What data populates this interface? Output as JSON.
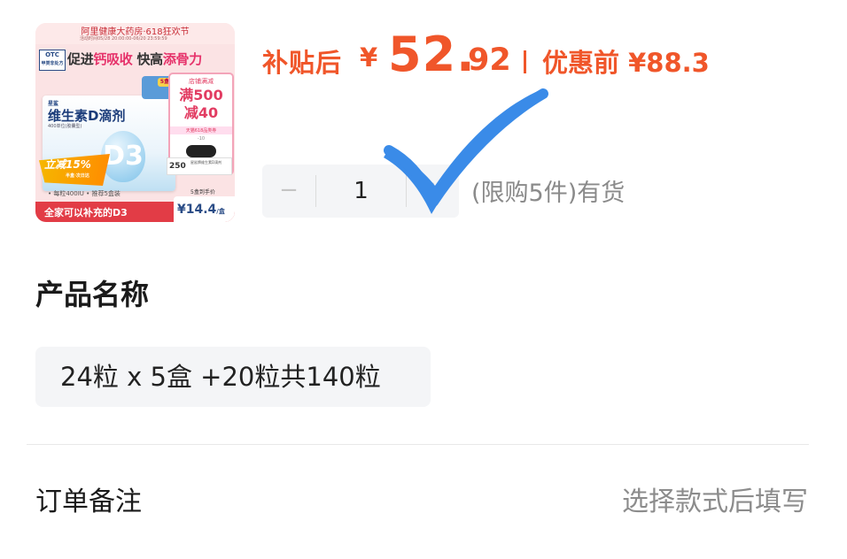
{
  "product_image": {
    "top_banner": "阿里健康大药房·618狂欢节",
    "date_text": "活动时间05/28 20:00:00-06/20 23:59:59",
    "otc_badge": "OTC",
    "otc_sub": "甲类非处方",
    "headline_part1": "促进",
    "headline_pink1": "钙吸收",
    "headline_part2": " 快高",
    "headline_pink2": "添骨力",
    "box_brand": "星鲨",
    "box_name": "维生素D滴剂",
    "box_spec": "400单位(胶囊型)",
    "box_d3": "D3",
    "box_count": "5盒",
    "promo_line1": "店铺满减",
    "promo_line2a": "满500",
    "promo_line2b": "减40",
    "promo_line3": "天猫618品类券",
    "promo_line4": "-10",
    "stamp_number": "250",
    "stamp_text": "星鲨牌维生素D滴剂",
    "flash_text": "立减15%",
    "flash_sub": "半盒·次日达",
    "bullets": "• 每粒400IU • 推荐5盒装",
    "per_unit_label": "5盒到手价",
    "slogan": "全家可以补充的D3",
    "unit_price": "¥14.4",
    "unit_price_suffix": "/盒"
  },
  "price": {
    "subsidy_label": "补贴后",
    "currency": "¥",
    "integer": "52.",
    "decimal": "92",
    "original_label": "优惠前 ¥88.3"
  },
  "quantity": {
    "minus": "−",
    "value": "1",
    "plus": "+",
    "note": "(限购5件)有货"
  },
  "product_name_section": {
    "title": "产品名称",
    "selected_option": "24粒 x 5盒 +20粒共140粒"
  },
  "order_note": {
    "label": "订单备注",
    "hint": "选择款式后填写"
  },
  "colors": {
    "price_accent": "#f0562a",
    "checkmark": "#3a8be8",
    "chip_bg": "#f4f5f7"
  }
}
